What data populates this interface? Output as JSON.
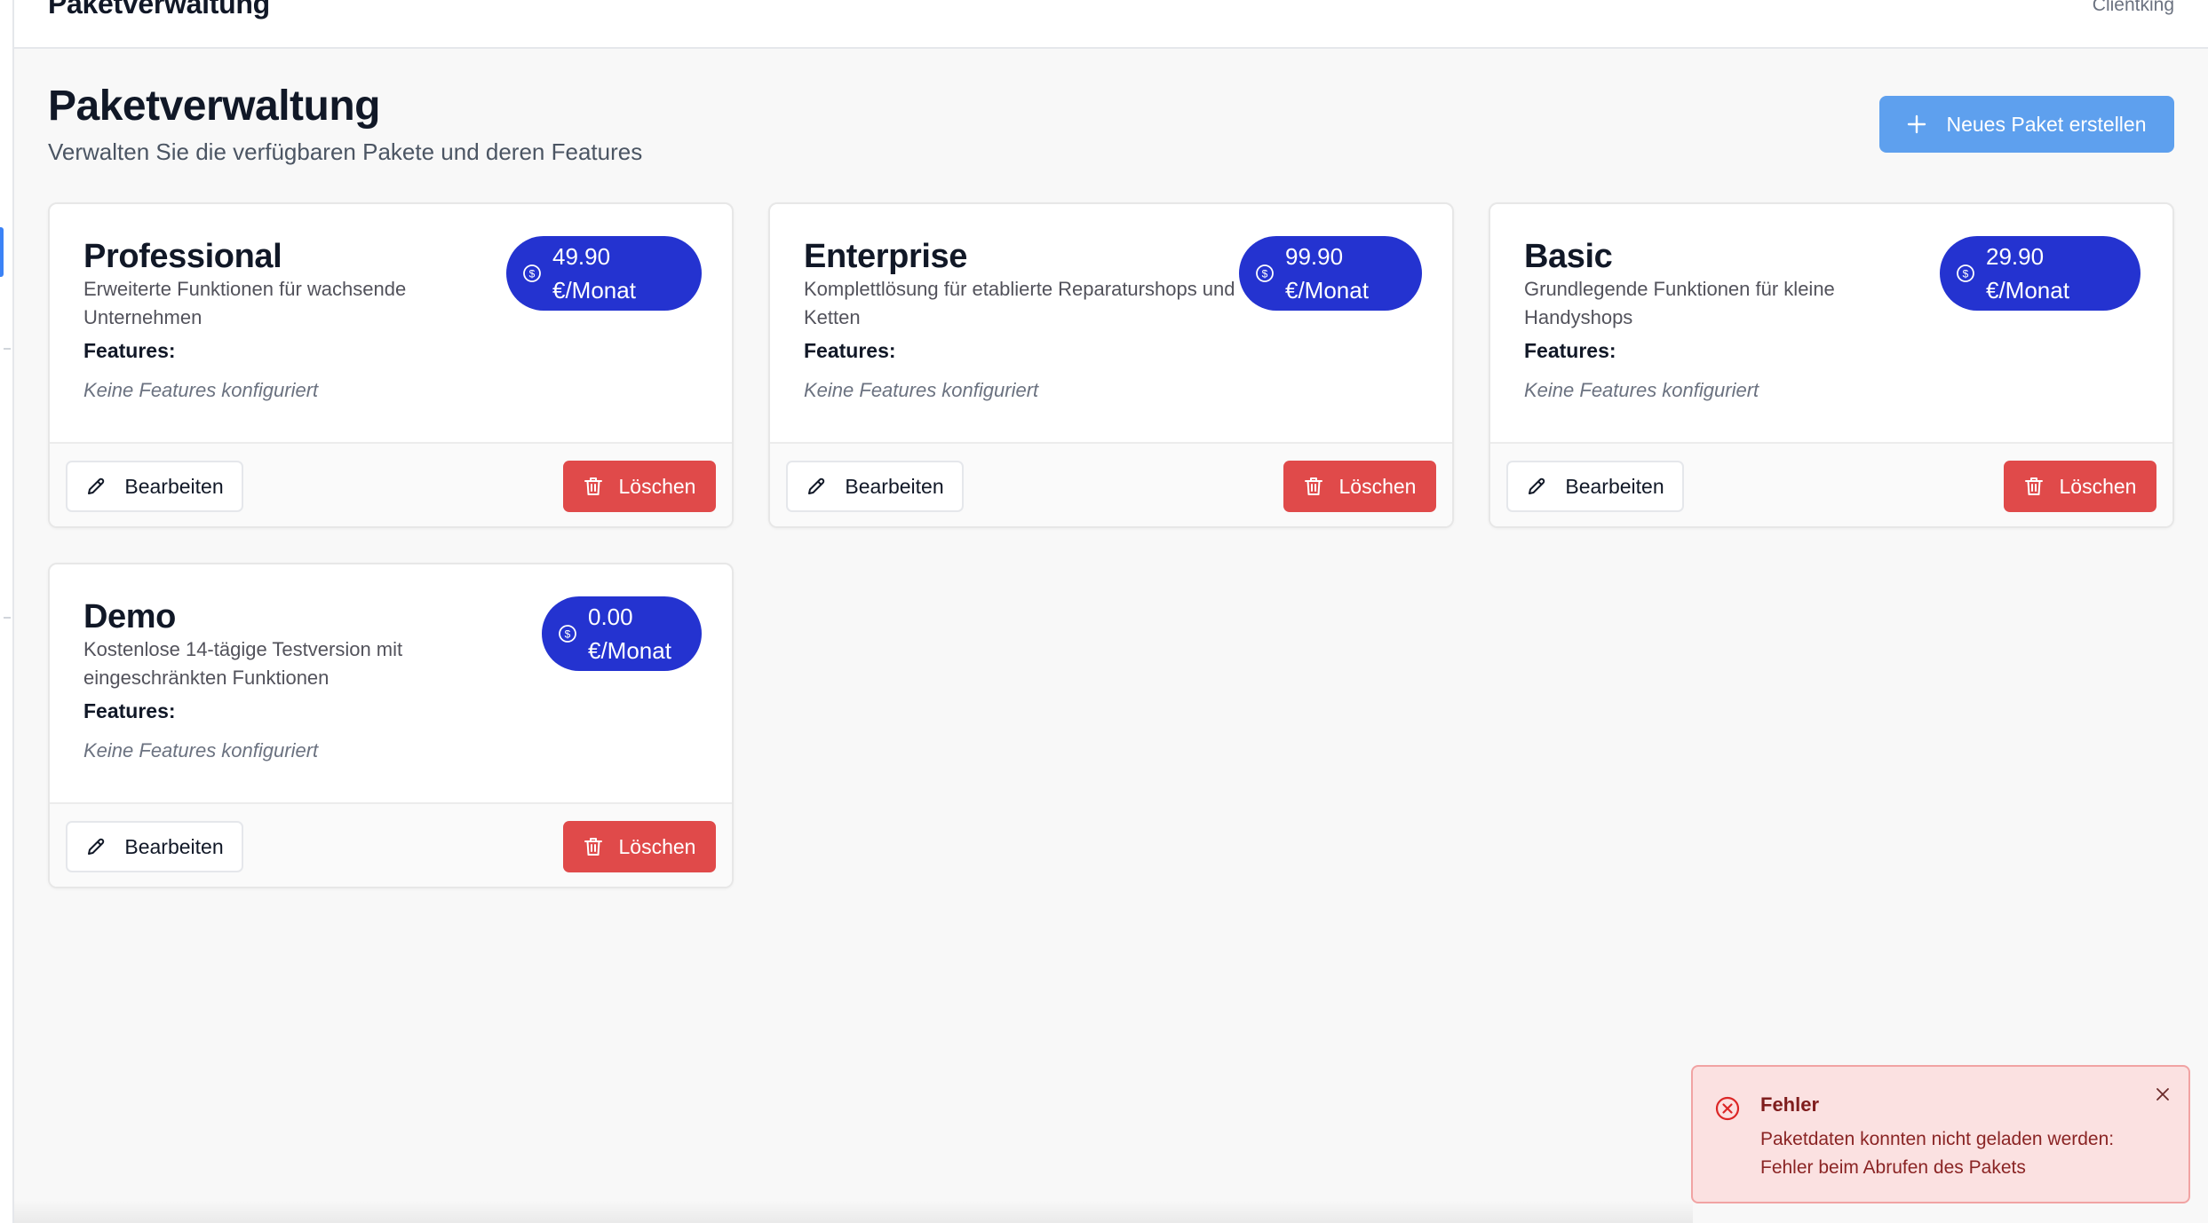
{
  "header": {
    "title": "Paketverwaltung",
    "user": "Clientking"
  },
  "page": {
    "title": "Paketverwaltung",
    "subtitle": "Verwalten Sie die verfügbaren Pakete und deren Features",
    "new_button_label": "Neues Paket erstellen"
  },
  "packages": [
    {
      "name": "Professional",
      "description": "Erweiterte Funktionen für wachsende Unternehmen",
      "price": "49.90",
      "price_unit": "€/Monat",
      "features_label": "Features:",
      "features_empty": "Keine Features konfiguriert",
      "edit_label": "Bearbeiten",
      "delete_label": "Löschen"
    },
    {
      "name": "Enterprise",
      "description": "Komplettlösung für etablierte Reparaturshops und Ketten",
      "price": "99.90",
      "price_unit": "€/Monat",
      "features_label": "Features:",
      "features_empty": "Keine Features konfiguriert",
      "edit_label": "Bearbeiten",
      "delete_label": "Löschen"
    },
    {
      "name": "Basic",
      "description": "Grundlegende Funktionen für kleine Handyshops",
      "price": "29.90",
      "price_unit": "€/Monat",
      "features_label": "Features:",
      "features_empty": "Keine Features konfiguriert",
      "edit_label": "Bearbeiten",
      "delete_label": "Löschen"
    },
    {
      "name": "Demo",
      "description": "Kostenlose 14-tägige Testversion mit eingeschränkten Funktionen",
      "price": "0.00",
      "price_unit": "€/Monat",
      "features_label": "Features:",
      "features_empty": "Keine Features konfiguriert",
      "edit_label": "Bearbeiten",
      "delete_label": "Löschen"
    }
  ],
  "toast": {
    "title": "Fehler",
    "message": "Paketdaten konnten nicht geladen werden: Fehler beim Abrufen des Pakets"
  },
  "icons": {
    "plus": "plus-icon",
    "price": "dollar-circle-icon",
    "edit": "pencil-icon",
    "delete": "trash-icon",
    "error": "x-circle-icon",
    "close": "close-icon"
  },
  "colors": {
    "primary_button": "#5ea0ee",
    "price_pill": "#2433d0",
    "delete_button": "#e04a4a",
    "toast_background": "#fbe1e1",
    "toast_text": "#7f1d1d"
  }
}
